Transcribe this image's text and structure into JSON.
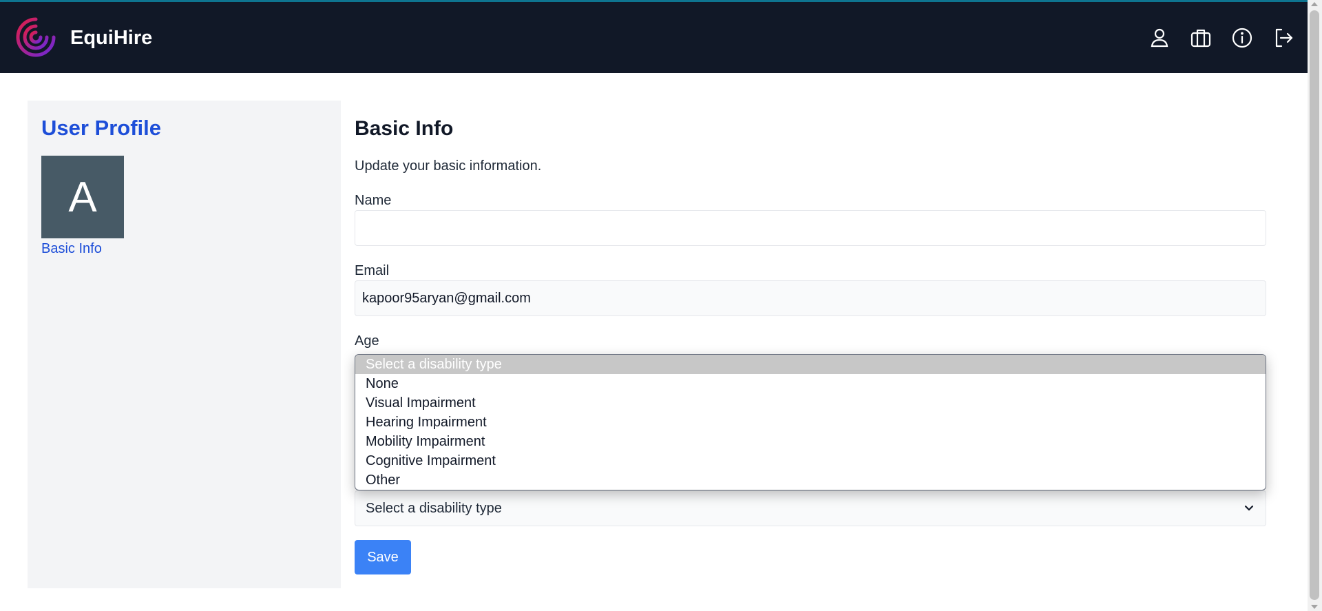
{
  "app": {
    "name": "EquiHire"
  },
  "header": {
    "icons": [
      "user-icon",
      "briefcase-icon",
      "info-icon",
      "logout-icon"
    ]
  },
  "sidebar": {
    "title": "User Profile",
    "avatar_letter": "A",
    "links": [
      {
        "label": "Basic Info"
      }
    ]
  },
  "main": {
    "title": "Basic Info",
    "subtitle": "Update your basic information.",
    "fields": {
      "name": {
        "label": "Name",
        "value": ""
      },
      "email": {
        "label": "Email",
        "value": "kapoor95aryan@gmail.com"
      },
      "age": {
        "label": "Age"
      }
    },
    "disability": {
      "selected": "Select a disability type",
      "options": [
        "Select a disability type",
        "None",
        "Visual Impairment",
        "Hearing Impairment",
        "Mobility Impairment",
        "Cognitive Impairment",
        "Other"
      ]
    },
    "save_label": "Save"
  },
  "colors": {
    "header_bg": "#111827",
    "accent": "#1d4ed8",
    "button": "#3b82f6",
    "sidebar_bg": "#f3f4f6",
    "avatar_bg": "#475a66"
  }
}
